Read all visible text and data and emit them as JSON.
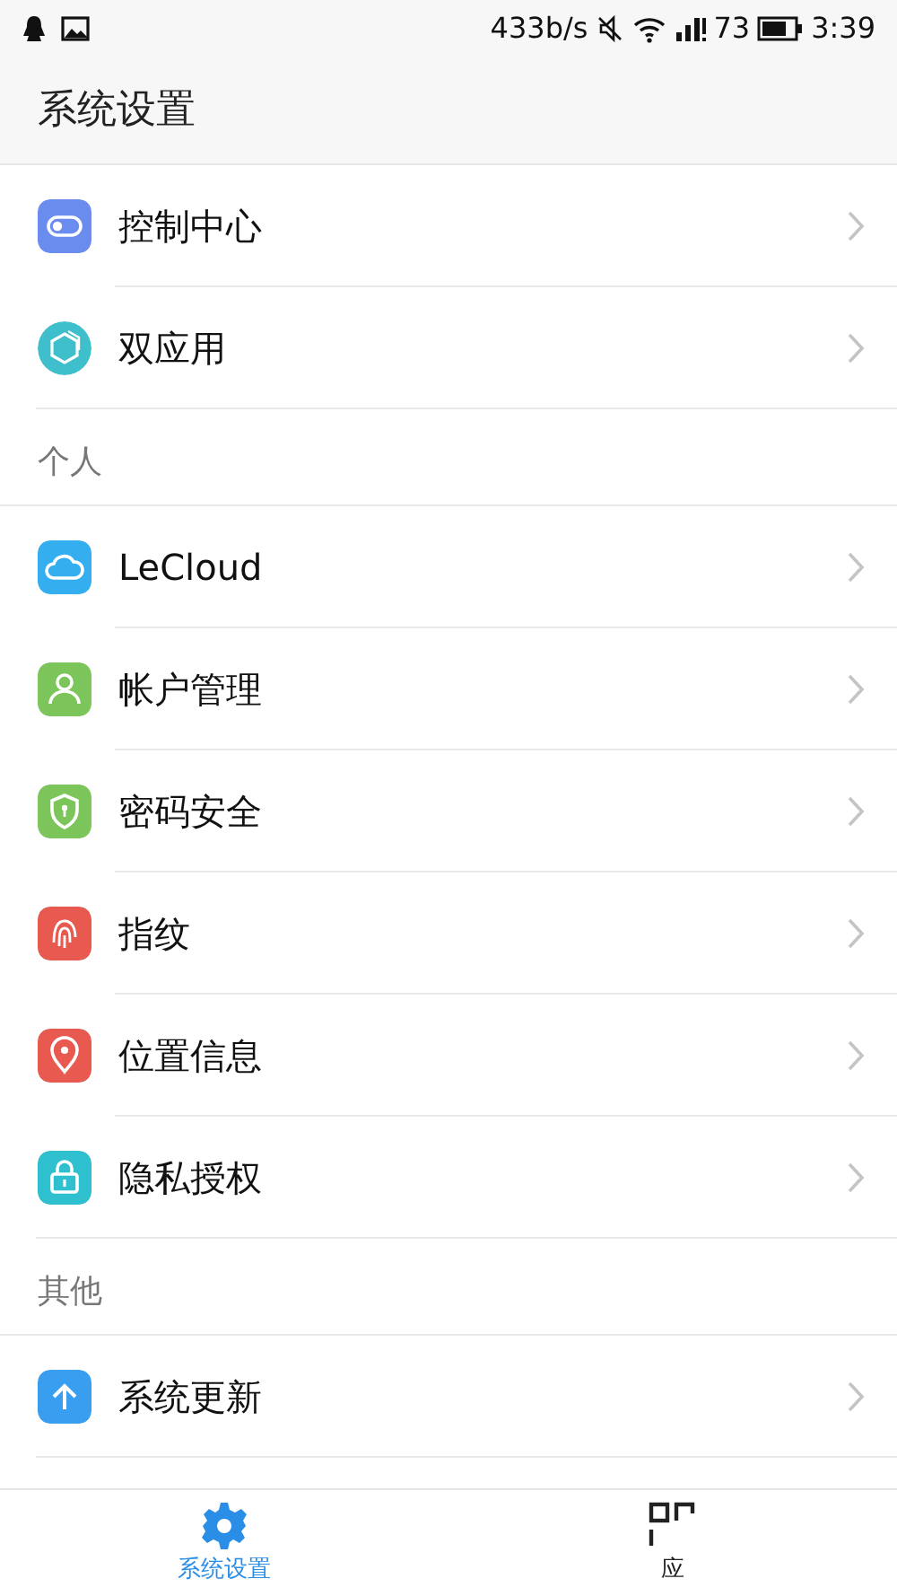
{
  "status_bar": {
    "speed": "433b/s",
    "battery_percent": "73",
    "time": "3:39"
  },
  "header": {
    "title": "系统设置"
  },
  "sections": [
    {
      "items": [
        {
          "label": "控制中心",
          "kind": "toggle",
          "color": "#6b8cef"
        },
        {
          "label": "双应用",
          "kind": "hexagon",
          "color": "#3fbfcc"
        }
      ]
    },
    {
      "title": "个人",
      "items": [
        {
          "label": "LeCloud",
          "kind": "cloud",
          "color": "#35aef0"
        },
        {
          "label": "帐户管理",
          "kind": "person",
          "color": "#7bc55a"
        },
        {
          "label": "密码安全",
          "kind": "shield",
          "color": "#7bc55a"
        },
        {
          "label": "指纹",
          "kind": "fingerprint",
          "color": "#e85a50"
        },
        {
          "label": "位置信息",
          "kind": "pin",
          "color": "#e85a50"
        },
        {
          "label": "隐私授权",
          "kind": "lock",
          "color": "#2fc0d0"
        }
      ]
    },
    {
      "title": "其他",
      "items": [
        {
          "label": "系统更新",
          "kind": "upload",
          "color": "#3a9ef0"
        }
      ]
    }
  ],
  "bottom_tabs": [
    {
      "label": "系统设置",
      "kind": "gear",
      "selected": true
    },
    {
      "label": "应",
      "kind": "apps",
      "selected": false
    }
  ]
}
